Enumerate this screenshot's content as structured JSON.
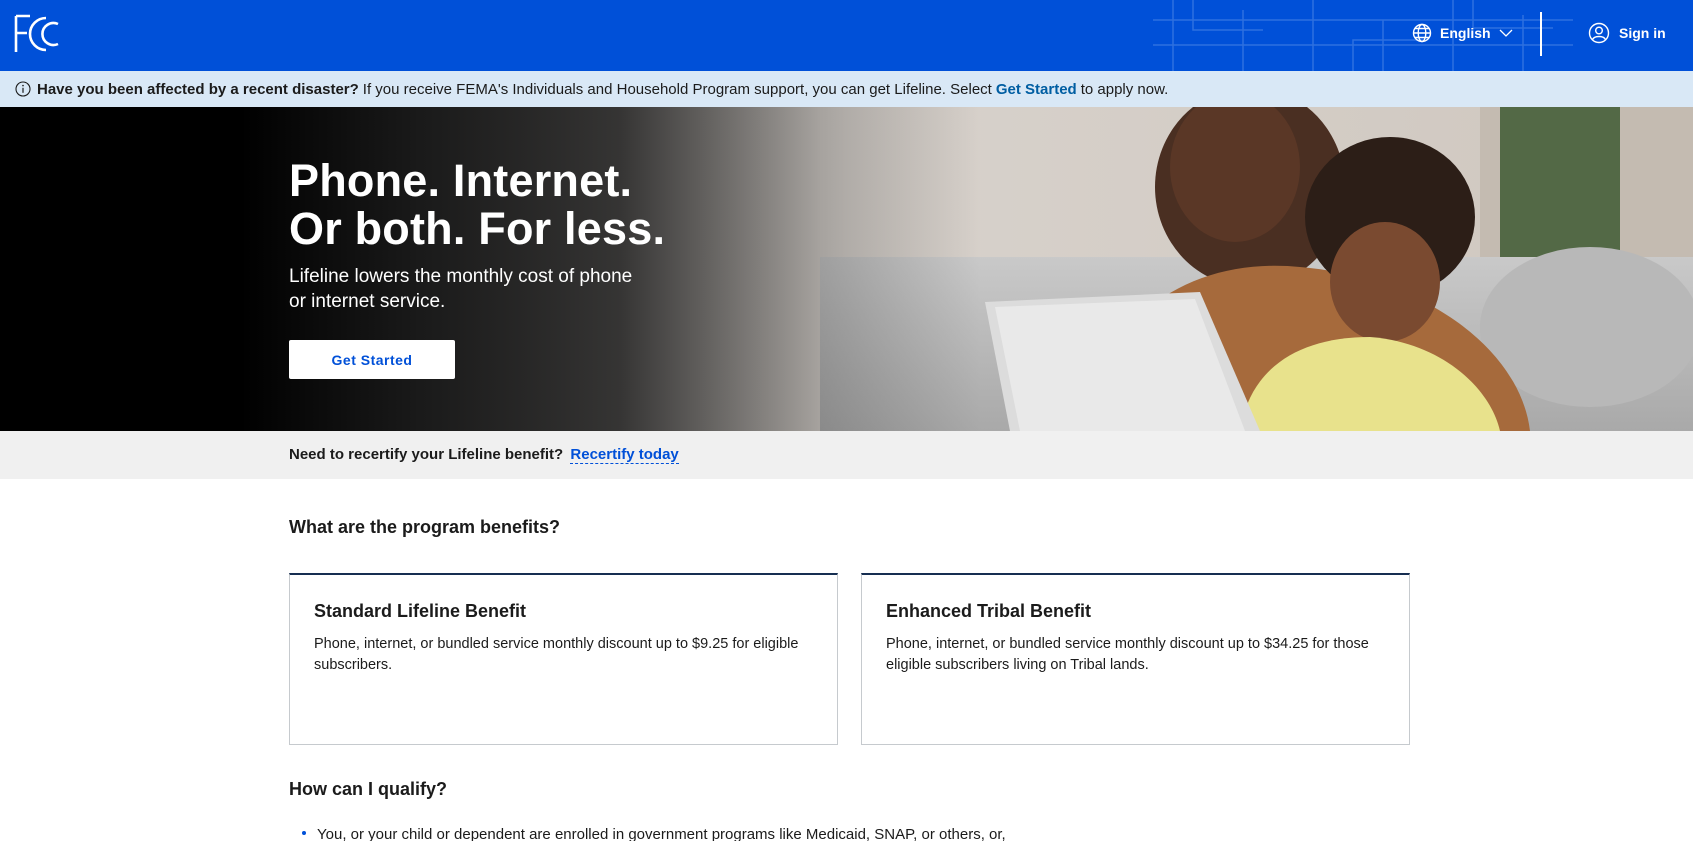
{
  "header": {
    "logo_text": "FCC",
    "language_label": "English",
    "signin_label": "Sign in",
    "icons": [
      "fcc-logo",
      "globe-icon",
      "chevron-down-icon",
      "user-icon"
    ]
  },
  "alert": {
    "bold_text": "Have you been affected by a recent disaster?",
    "text_before_link": "If you receive FEMA's Individuals and Household Program support, you can get Lifeline. Select",
    "link_text": "Get Started",
    "text_after_link": "to apply now.",
    "icon": "info-icon"
  },
  "hero": {
    "title_line1": "Phone. Internet.",
    "title_line2": "Or both. For less.",
    "subtitle": "Lifeline lowers the monthly cost of phone or internet service.",
    "cta_label": "Get Started"
  },
  "recertify": {
    "question": "Need to recertify your Lifeline benefit?",
    "link_text": "Recertify today"
  },
  "benefits": {
    "heading": "What are the program benefits?",
    "cards": [
      {
        "title": "Standard Lifeline Benefit",
        "body": "Phone, internet, or bundled service monthly discount up to $9.25 for eligible subscribers."
      },
      {
        "title": "Enhanced Tribal Benefit",
        "body": "Phone, internet, or bundled service monthly discount up to $34.25 for those eligible subscribers living on Tribal lands."
      }
    ]
  },
  "qualify": {
    "heading": "How can I qualify?",
    "items": [
      "You, or your child or dependent are enrolled in government programs like Medicaid, SNAP, or others, or,"
    ]
  },
  "colors": {
    "header_bg": "#0050d8",
    "alert_bg": "#d9e8f6",
    "link": "#005ea2",
    "recert_bg": "#f0f0f0",
    "card_top_border": "#162e51"
  }
}
